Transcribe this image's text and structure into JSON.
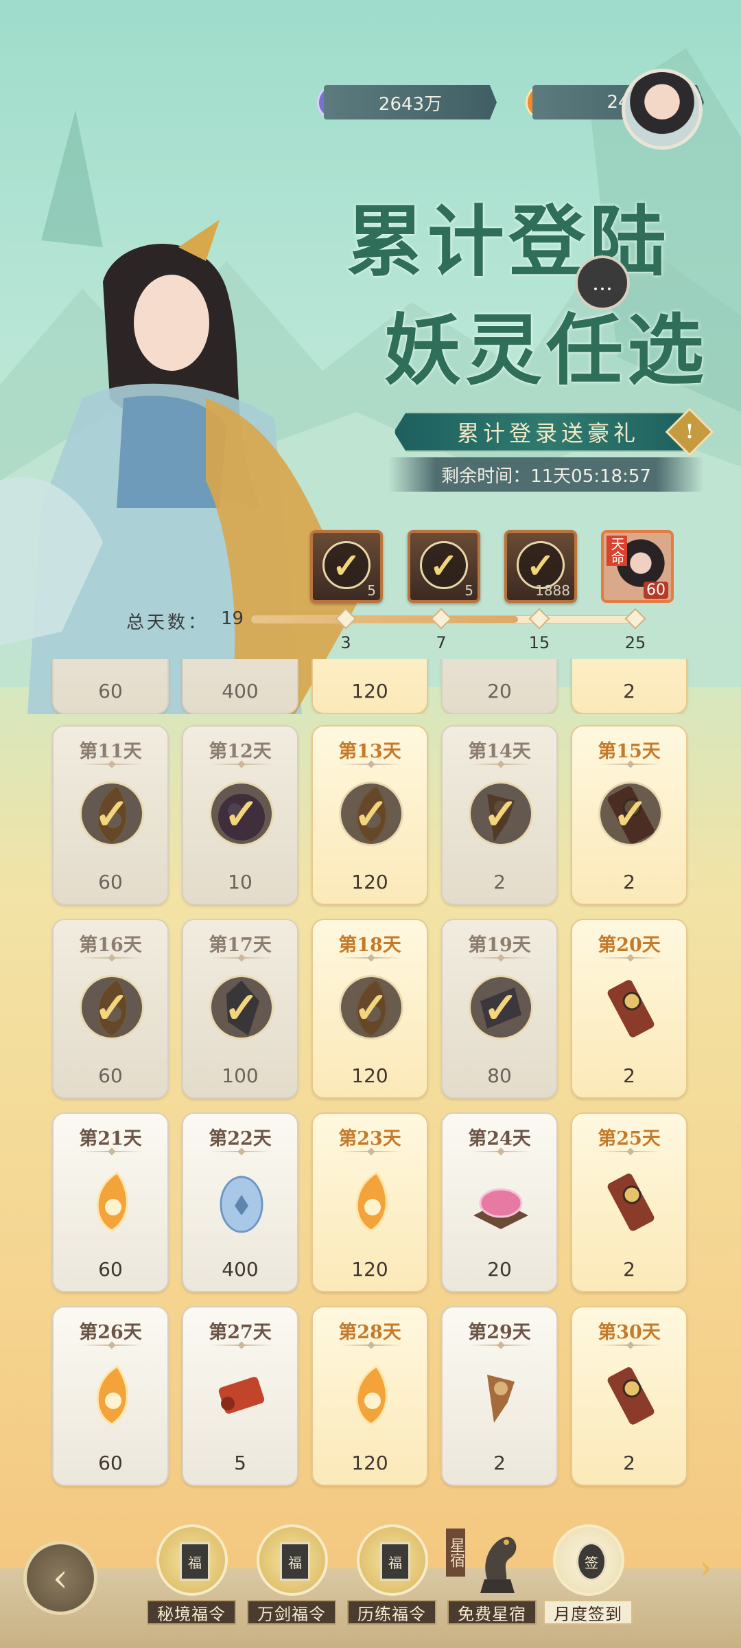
{
  "currency": [
    {
      "icon": "jade-currency-icon",
      "value": "2643万"
    },
    {
      "icon": "flame-currency-icon",
      "value": "24"
    }
  ],
  "title": {
    "line1": "累计登陆",
    "line2": "妖灵任选"
  },
  "chat_icon": "…",
  "banner": "累计登录送豪礼",
  "info_mark": "!",
  "timer": "剩余时间：11天05:18:57",
  "milestones": {
    "total_label": "总天数：",
    "total_value": "19",
    "progress_fraction": 0.69,
    "rewards": [
      {
        "qty": "5",
        "claimed": true,
        "day": "3"
      },
      {
        "qty": "5",
        "claimed": true,
        "day": "7"
      },
      {
        "qty": "1888",
        "claimed": true,
        "day": "15"
      },
      {
        "qty": "60",
        "claimed": false,
        "day": "25",
        "tag": "天命"
      }
    ]
  },
  "partial_row": [
    "60",
    "400",
    "120",
    "20",
    "2"
  ],
  "days": [
    {
      "label": "第11天",
      "qty": "60",
      "claimed": true,
      "style": "plain",
      "item": "flame-token-icon"
    },
    {
      "label": "第12天",
      "qty": "10",
      "claimed": true,
      "style": "plain",
      "item": "purple-orb-icon"
    },
    {
      "label": "第13天",
      "qty": "120",
      "claimed": true,
      "style": "gold",
      "item": "flame-token-icon"
    },
    {
      "label": "第14天",
      "qty": "2",
      "claimed": true,
      "style": "plain",
      "item": "tassel-pendant-icon"
    },
    {
      "label": "第15天",
      "qty": "2",
      "claimed": true,
      "style": "gold",
      "item": "talisman-icon"
    },
    {
      "label": "第16天",
      "qty": "60",
      "claimed": true,
      "style": "plain",
      "item": "flame-token-icon"
    },
    {
      "label": "第17天",
      "qty": "100",
      "claimed": true,
      "style": "plain",
      "item": "crystal-icon"
    },
    {
      "label": "第18天",
      "qty": "120",
      "claimed": true,
      "style": "gold",
      "item": "flame-token-icon"
    },
    {
      "label": "第19天",
      "qty": "80",
      "claimed": true,
      "style": "plain",
      "item": "scroll-icon"
    },
    {
      "label": "第20天",
      "qty": "2",
      "claimed": false,
      "style": "gold",
      "item": "talisman-icon"
    },
    {
      "label": "第21天",
      "qty": "60",
      "claimed": false,
      "style": "plain",
      "item": "flame-token-icon"
    },
    {
      "label": "第22天",
      "qty": "400",
      "claimed": false,
      "style": "plain",
      "item": "spirit-egg-icon"
    },
    {
      "label": "第23天",
      "qty": "120",
      "claimed": false,
      "style": "gold",
      "item": "flame-token-icon"
    },
    {
      "label": "第24天",
      "qty": "20",
      "claimed": false,
      "style": "plain",
      "item": "pink-gem-stand-icon"
    },
    {
      "label": "第25天",
      "qty": "2",
      "claimed": false,
      "style": "gold",
      "item": "talisman-icon"
    },
    {
      "label": "第26天",
      "qty": "60",
      "claimed": false,
      "style": "plain",
      "item": "flame-token-icon"
    },
    {
      "label": "第27天",
      "qty": "5",
      "claimed": false,
      "style": "plain",
      "item": "red-scroll-icon"
    },
    {
      "label": "第28天",
      "qty": "120",
      "claimed": false,
      "style": "gold",
      "item": "flame-token-icon"
    },
    {
      "label": "第29天",
      "qty": "2",
      "claimed": false,
      "style": "plain",
      "item": "tassel-pendant-icon"
    },
    {
      "label": "第30天",
      "qty": "2",
      "claimed": false,
      "style": "gold",
      "item": "talisman-icon"
    }
  ],
  "bottom_nav": {
    "back_icon": "back-arrow-icon",
    "tabs": [
      {
        "label": "秘境福令",
        "glyph": "福",
        "active": false
      },
      {
        "label": "万剑福令",
        "glyph": "福",
        "active": false
      },
      {
        "label": "历练福令",
        "glyph": "福",
        "active": false
      },
      {
        "label": "免费星宿",
        "glyph": "",
        "badge": "星宿",
        "active": false
      },
      {
        "label": "月度签到",
        "glyph": "签",
        "active": true
      }
    ],
    "next_icon": "›"
  },
  "colors": {
    "gold_text": "#c47a2a",
    "teal_title": "#2f6e58",
    "banner": "#1d5f5e"
  }
}
